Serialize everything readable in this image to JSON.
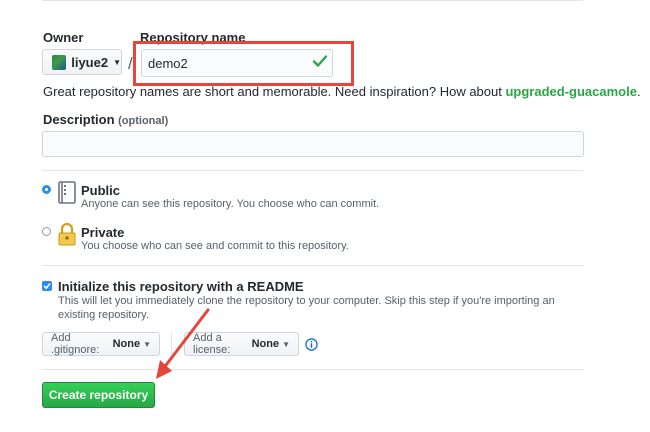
{
  "form": {
    "owner_label": "Owner",
    "owner_name": "liyue2",
    "repo_label": "Repository name",
    "repo_value": "demo2",
    "slash": "/",
    "hint_text": "Great repository names are short and memorable. Need inspiration? How about ",
    "hint_suggestion": "upgraded-guacamole",
    "hint_end": ".",
    "description_label": "Description",
    "description_optional": "(optional)",
    "description_value": ""
  },
  "visibility": {
    "selected": "public",
    "public_title": "Public",
    "public_note": "Anyone can see this repository. You choose who can commit.",
    "private_title": "Private",
    "private_note": "You choose who can see and commit to this repository."
  },
  "init": {
    "checked": true,
    "readme_title": "Initialize this repository with a README",
    "readme_note": "This will let you immediately clone the repository to your computer. Skip this step if you're importing an existing repository.",
    "gitignore_label": "Add .gitignore:",
    "gitignore_value": "None",
    "license_label": "Add a license:",
    "license_value": "None"
  },
  "actions": {
    "create_label": "Create repository"
  },
  "colors": {
    "accent_green": "#28a745",
    "annotation_red": "#e5463c",
    "radio_blue": "#2d8cf0"
  },
  "icons": {
    "avatar": "avatar",
    "caret": "caret-down-icon",
    "check": "check-icon",
    "public": "repo-icon",
    "private": "lock-icon",
    "info": "info-icon"
  }
}
